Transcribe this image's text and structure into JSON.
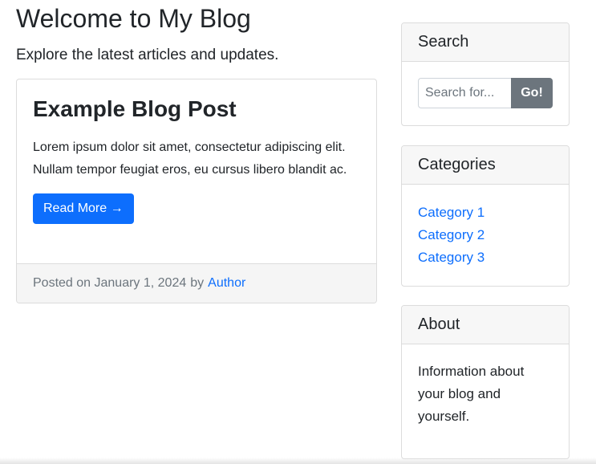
{
  "header": {
    "title": "Welcome to My Blog",
    "subtitle": "Explore the latest articles and updates."
  },
  "post": {
    "title": "Example Blog Post",
    "excerpt": "Lorem ipsum dolor sit amet, consectetur adipiscing elit. Nullam tempor feugiat eros, eu cursus libero blandit ac.",
    "read_more_label": "Read More →",
    "footer": {
      "posted_on": "Posted on January 1, 2024",
      "by": "by",
      "author": "Author"
    }
  },
  "sidebar": {
    "search": {
      "title": "Search",
      "placeholder": "Search for...",
      "button_label": "Go!"
    },
    "categories": {
      "title": "Categories",
      "items": [
        "Category 1",
        "Category 2",
        "Category 3"
      ]
    },
    "about": {
      "title": "About",
      "text": "Information about your blog and yourself."
    }
  },
  "colors": {
    "primary": "#0d6efd",
    "secondary": "#6c757d",
    "text": "#212529",
    "card_header_bg": "#f7f7f7",
    "border": "#dcdcdc"
  }
}
